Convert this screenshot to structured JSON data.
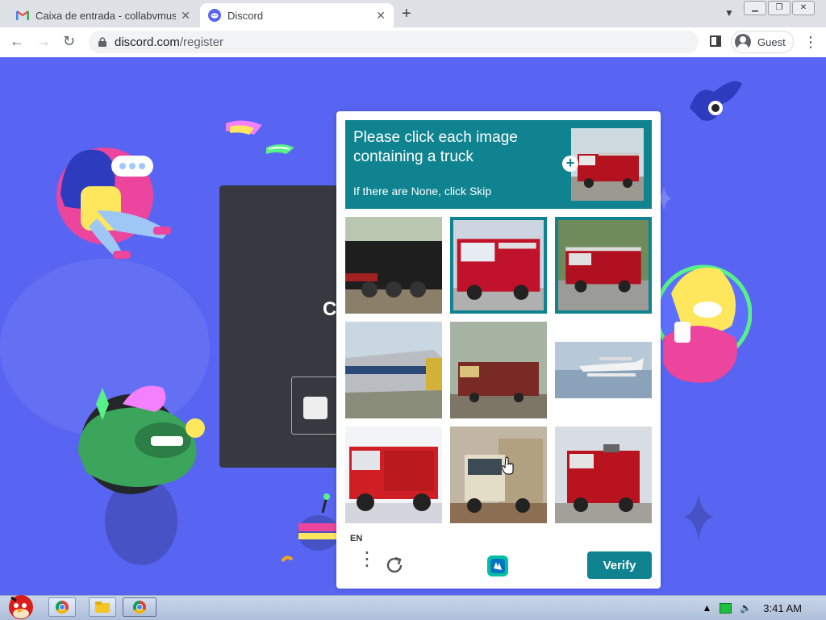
{
  "browser": {
    "tabs": [
      {
        "title": "Caixa de entrada - collabvmus",
        "favicon": "gmail-icon"
      },
      {
        "title": "Discord",
        "favicon": "discord-icon"
      }
    ],
    "url_host": "discord.com",
    "url_path": "/register",
    "profile_label": "Guest"
  },
  "captcha": {
    "prompt": "Please click each image containing a truck",
    "subprompt": "If there are None, click Skip",
    "language": "EN",
    "verify_label": "Verify",
    "tiles": [
      {
        "content": "steam locomotive",
        "selected": false
      },
      {
        "content": "fire truck",
        "selected": true
      },
      {
        "content": "fire truck",
        "selected": true
      },
      {
        "content": "passenger train",
        "selected": false
      },
      {
        "content": "freight locomotive",
        "selected": false
      },
      {
        "content": "seaplane",
        "selected": false
      },
      {
        "content": "fire truck",
        "selected": false
      },
      {
        "content": "cargo truck",
        "selected": false
      },
      {
        "content": "fire truck",
        "selected": false
      }
    ]
  },
  "taskbar": {
    "clock": "3:41 AM"
  },
  "colors": {
    "discord_blurple": "#5865f2",
    "captcha_teal": "#0f8390"
  }
}
